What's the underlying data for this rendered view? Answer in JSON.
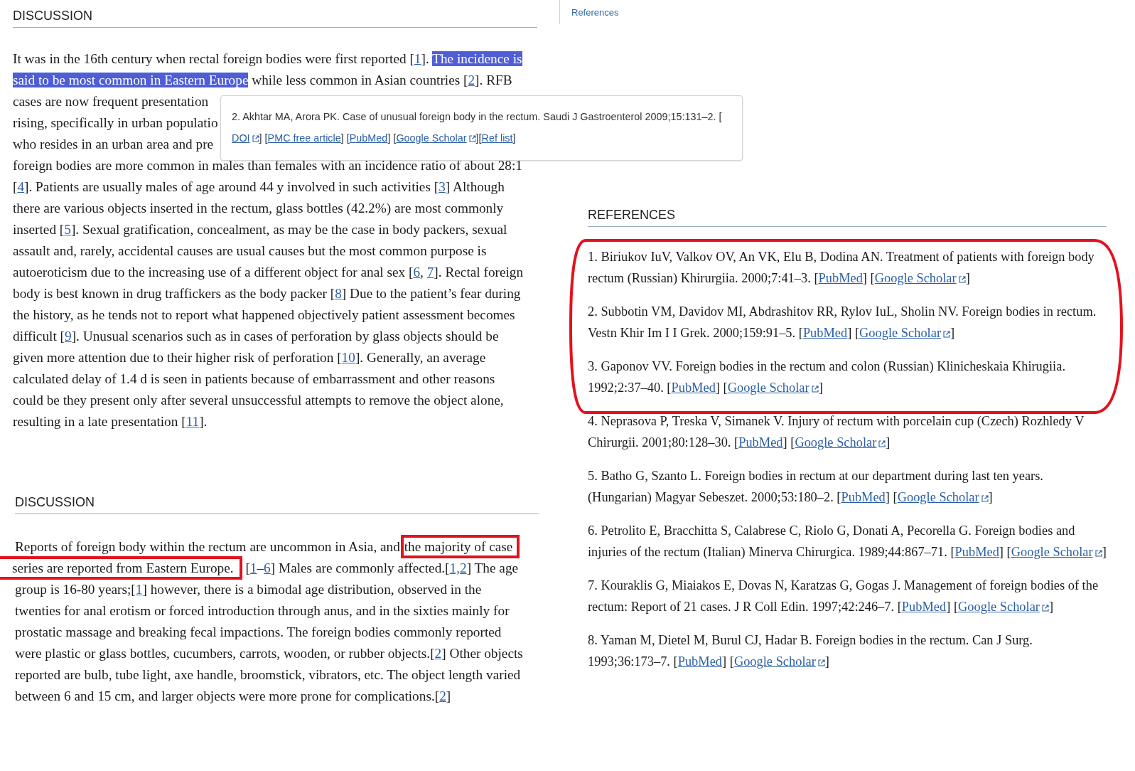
{
  "article": {
    "sections": [
      {
        "heading": "DISCUSSION",
        "lines": [
          [
            {
              "kind": "text",
              "text": "It was in the 16th century when rectal foreign bodies were first reported ["
            },
            {
              "kind": "link",
              "text": "1"
            },
            {
              "kind": "text",
              "text": "]. "
            },
            {
              "kind": "selection",
              "text": "The incidence is"
            }
          ],
          [
            {
              "kind": "selection",
              "text": "said to be most common in Eastern Europe"
            },
            {
              "kind": "text",
              "text": " while less common in Asian countries ["
            },
            {
              "kind": "link",
              "text": "2"
            },
            {
              "kind": "text",
              "text": "]. RFB"
            }
          ],
          [
            {
              "kind": "text",
              "text": "cases are now frequent presentation"
            }
          ],
          [
            {
              "kind": "text",
              "text": "rising, specifically in urban populatio"
            }
          ],
          [
            {
              "kind": "text",
              "text": "who resides in an urban area and pre"
            }
          ],
          [
            {
              "kind": "text",
              "text": "foreign bodies are more common in males than females with an incidence ratio of about 28:1"
            }
          ],
          [
            {
              "kind": "text",
              "text": "["
            },
            {
              "kind": "link",
              "text": "4"
            },
            {
              "kind": "text",
              "text": "]. Patients are usually males of age around 44 y involved in such activities ["
            },
            {
              "kind": "link",
              "text": "3"
            },
            {
              "kind": "text",
              "text": "] Although"
            }
          ],
          [
            {
              "kind": "text",
              "text": "there are various objects inserted in the rectum, glass bottles (42.2%) are most commonly"
            }
          ],
          [
            {
              "kind": "text",
              "text": "inserted ["
            },
            {
              "kind": "link",
              "text": "5"
            },
            {
              "kind": "text",
              "text": "]. Sexual gratification, concealment, as may be the case in body packers, sexual"
            }
          ],
          [
            {
              "kind": "text",
              "text": "assault and, rarely, accidental causes are usual causes but the most common purpose is"
            }
          ],
          [
            {
              "kind": "text",
              "text": "autoeroticism due to the increasing use of a different object for anal sex ["
            },
            {
              "kind": "link",
              "text": "6"
            },
            {
              "kind": "text",
              "text": ", "
            },
            {
              "kind": "link",
              "text": "7"
            },
            {
              "kind": "text",
              "text": "]. Rectal foreign"
            }
          ],
          [
            {
              "kind": "text",
              "text": "body is best known in drug traffickers as the body packer ["
            },
            {
              "kind": "link",
              "text": "8"
            },
            {
              "kind": "text",
              "text": "] Due to the patient’s fear during"
            }
          ],
          [
            {
              "kind": "text",
              "text": "the history, as he tends not to report what happened objectively patient assessment becomes"
            }
          ],
          [
            {
              "kind": "text",
              "text": "difficult ["
            },
            {
              "kind": "link",
              "text": "9"
            },
            {
              "kind": "text",
              "text": "]. Unusual scenarios such as in cases of perforation by glass objects should be"
            }
          ],
          [
            {
              "kind": "text",
              "text": "given more attention due to their higher risk of perforation ["
            },
            {
              "kind": "link",
              "text": "10"
            },
            {
              "kind": "text",
              "text": "]. Generally, an average"
            }
          ],
          [
            {
              "kind": "text",
              "text": "calculated delay of 1.4 d is seen in patients because of embarrassment and other reasons"
            }
          ],
          [
            {
              "kind": "text",
              "text": "could be they present only after several unsuccessful attempts to remove the object alone,"
            }
          ],
          [
            {
              "kind": "text",
              "text": "resulting in a late presentation ["
            },
            {
              "kind": "link",
              "text": "11"
            },
            {
              "kind": "text",
              "text": "]."
            }
          ]
        ]
      },
      {
        "heading": "DISCUSSION",
        "lines": [
          [
            {
              "kind": "text",
              "text": "Reports of foreign body within the rectum are uncommon in Asia, and "
            },
            {
              "kind": "boxed",
              "text": "the majority of case"
            }
          ],
          [
            {
              "kind": "boxed_edge",
              "text": "series are reported from Eastern Europe."
            },
            {
              "kind": "text",
              "text": " ["
            },
            {
              "kind": "link",
              "text": "1"
            },
            {
              "kind": "text",
              "text": "–"
            },
            {
              "kind": "link",
              "text": "6"
            },
            {
              "kind": "text",
              "text": "] Males are commonly affected.["
            },
            {
              "kind": "link",
              "text": "1,2"
            },
            {
              "kind": "text",
              "text": "] The age"
            }
          ],
          [
            {
              "kind": "text",
              "text": "group is 16-80 years;["
            },
            {
              "kind": "link",
              "text": "1"
            },
            {
              "kind": "text",
              "text": "] however, there is a bimodal age distribution, observed in the"
            }
          ],
          [
            {
              "kind": "text",
              "text": "twenties for anal erotism or forced introduction through anus, and in the sixties mainly for"
            }
          ],
          [
            {
              "kind": "text",
              "text": "prostatic massage and breaking fecal impactions. The foreign bodies commonly reported"
            }
          ],
          [
            {
              "kind": "text",
              "text": "were plastic or glass bottles, cucumbers, carrots, wooden, or rubber objects.["
            },
            {
              "kind": "link",
              "text": "2"
            },
            {
              "kind": "text",
              "text": "] Other objects"
            }
          ],
          [
            {
              "kind": "text",
              "text": "reported are bulb, tube light, axe handle, broomstick, vibrators, etc. The object length varied"
            }
          ],
          [
            {
              "kind": "text",
              "text": "between 6 and 15 cm, and larger objects were more prone for complications.["
            },
            {
              "kind": "link",
              "text": "2"
            },
            {
              "kind": "text",
              "text": "]"
            }
          ]
        ]
      }
    ]
  },
  "popup": {
    "lines": [
      [
        {
          "kind": "text",
          "text": "2. Akhtar MA, Arora PK. Case of unusual foreign body in the rectum. Saudi J Gastroenterol 2009;15:131–2. ["
        }
      ],
      [
        {
          "kind": "external_link",
          "text": "DOI"
        },
        {
          "kind": "text",
          "text": "] ["
        },
        {
          "kind": "link",
          "text": "PMC free article"
        },
        {
          "kind": "text",
          "text": "] ["
        },
        {
          "kind": "link",
          "text": "PubMed"
        },
        {
          "kind": "text",
          "text": "] ["
        },
        {
          "kind": "external_link",
          "text": "Google Scholar"
        },
        {
          "kind": "text",
          "text": "]["
        },
        {
          "kind": "link",
          "text": "Ref list"
        },
        {
          "kind": "text",
          "text": "]"
        }
      ]
    ]
  },
  "sidebar": {
    "nav_link": "References",
    "heading": "REFERENCES",
    "references": [
      [
        {
          "kind": "text",
          "text": "1. Biriukov IuV, Valkov OV, An VK, Elu B, Dodina AN. Treatment of patients with foreign body rectum (Russian) Khirurgiia. 2000;7:41–3. ["
        },
        {
          "kind": "link",
          "text": "PubMed"
        },
        {
          "kind": "text",
          "text": "] ["
        },
        {
          "kind": "external_link",
          "text": "Google Scholar"
        },
        {
          "kind": "text",
          "text": "]"
        }
      ],
      [
        {
          "kind": "text",
          "text": "2. Subbotin VM, Davidov MI, Abdrashitov RR, Rylov IuL, Sholin NV. Foreign bodies in rectum. Vestn Khir Im I I Grek. 2000;159:91–5. ["
        },
        {
          "kind": "link",
          "text": "PubMed"
        },
        {
          "kind": "text",
          "text": "] ["
        },
        {
          "kind": "external_link",
          "text": "Google Scholar"
        },
        {
          "kind": "text",
          "text": "]"
        }
      ],
      [
        {
          "kind": "text",
          "text": "3. Gaponov VV. Foreign bodies in the rectum and colon (Russian) Klinicheskaia Khirugiia. 1992;2:37–40. ["
        },
        {
          "kind": "link",
          "text": "PubMed"
        },
        {
          "kind": "text",
          "text": "] ["
        },
        {
          "kind": "external_link",
          "text": "Google Scholar"
        },
        {
          "kind": "text",
          "text": "]"
        }
      ],
      [
        {
          "kind": "text",
          "text": "4. Neprasova P, Treska V, Simanek V. Injury of rectum with porcelain cup (Czech) Rozhledy V Chirurgii. 2001;80:128–30. ["
        },
        {
          "kind": "link",
          "text": "PubMed"
        },
        {
          "kind": "text",
          "text": "] ["
        },
        {
          "kind": "external_link",
          "text": "Google Scholar"
        },
        {
          "kind": "text",
          "text": "]"
        }
      ],
      [
        {
          "kind": "text",
          "text": "5. Batho G, Szanto L. Foreign bodies in rectum at our department during last ten years. (Hungarian) Magyar Sebeszet. 2000;53:180–2. ["
        },
        {
          "kind": "link",
          "text": "PubMed"
        },
        {
          "kind": "text",
          "text": "] ["
        },
        {
          "kind": "external_link",
          "text": "Google Scholar"
        },
        {
          "kind": "text",
          "text": "]"
        }
      ],
      [
        {
          "kind": "text",
          "text": "6. Petrolito E, Bracchitta S, Calabrese C, Riolo G, Donati A, Pecorella G. Foreign bodies and injuries of the rectum (Italian) Minerva Chirurgica. 1989;44:867–71. ["
        },
        {
          "kind": "link",
          "text": "PubMed"
        },
        {
          "kind": "text",
          "text": "] ["
        },
        {
          "kind": "external_link",
          "text": "Google Scholar"
        },
        {
          "kind": "text",
          "text": "]"
        }
      ],
      [
        {
          "kind": "text",
          "text": "7. Kouraklis G, Miaiakos E, Dovas N, Karatzas G, Gogas J. Management of foreign bodies of the rectum: Report of 21 cases. J R Coll Edin. 1997;42:246–7. ["
        },
        {
          "kind": "link",
          "text": "PubMed"
        },
        {
          "kind": "text",
          "text": "] ["
        },
        {
          "kind": "external_link",
          "text": "Google Scholar"
        },
        {
          "kind": "text",
          "text": "]"
        }
      ],
      [
        {
          "kind": "text",
          "text": "8. Yaman M, Dietel M, Burul CJ, Hadar B. Foreign bodies in the rectum. Can J Surg. 1993;36:173–7. ["
        },
        {
          "kind": "link",
          "text": "PubMed"
        },
        {
          "kind": "text",
          "text": "] ["
        },
        {
          "kind": "external_link",
          "text": "Google Scholar"
        },
        {
          "kind": "text",
          "text": "]"
        }
      ]
    ]
  },
  "annotations": [
    {
      "kind": "ellipse"
    }
  ]
}
